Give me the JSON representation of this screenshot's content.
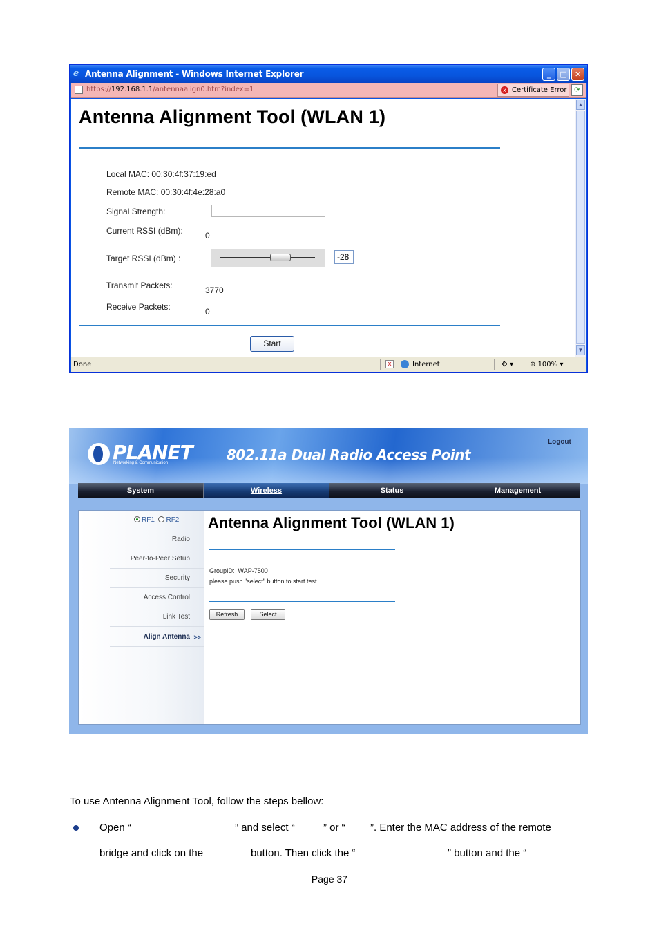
{
  "ie_window": {
    "title": "Antenna Alignment - Windows Internet Explorer",
    "url_prefix": "https://",
    "url_host": "192.168.1.1",
    "url_path": "/antennaalign0.htm?index=1",
    "cert_error": "Certificate Error",
    "status_done": "Done",
    "zone": "Internet",
    "zoom": "100%",
    "page": {
      "title": "Antenna Alignment Tool  (WLAN 1)",
      "local_mac_label": "Local MAC:",
      "local_mac": "00:30:4f:37:19:ed",
      "remote_mac_label": "Remote MAC:",
      "remote_mac": "00:30:4f:4e:28:a0",
      "signal_strength_label": "Signal Strength:",
      "current_rssi_label": "Current RSSI (dBm):",
      "current_rssi": "0",
      "target_rssi_label": "Target RSSI (dBm) :",
      "target_rssi": "-28",
      "transmit_packets_label": "Transmit Packets:",
      "transmit_packets": "3770",
      "receive_packets_label": "Receive Packets:",
      "receive_packets": "0",
      "start_button": "Start"
    }
  },
  "planet_ui": {
    "logo": "PLANET",
    "logo_sub": "Networking & Communication",
    "product": "802.11a Dual Radio Access Point",
    "logout": "Logout",
    "tabs": [
      "System",
      "Wireless",
      "Status",
      "Management"
    ],
    "rf1": "RF1",
    "rf2": "RF2",
    "menu": [
      "Radio",
      "Peer-to-Peer Setup",
      "Security",
      "Access Control",
      "Link Test",
      "Align Antenna"
    ],
    "menu_active_marker": ">>",
    "title": "Antenna Alignment Tool  (WLAN 1)",
    "group_label": "GroupID:",
    "group_id": "WAP-7500",
    "hint": "please push \"select\" button to start test",
    "refresh_button": "Refresh",
    "select_button": "Select"
  },
  "text": {
    "intro": "To use Antenna Alignment Tool, follow the steps bellow:",
    "step1_open": "Open “",
    "step1_select": "” and select “",
    "step1_or": "” or “",
    "step1_enter": "”.   Enter the MAC address of the remote",
    "step1_bridge": "bridge and click on the",
    "step1_button": "button.    Then click the “",
    "step1_and": "” button and the “",
    "page_number": "Page 37"
  }
}
